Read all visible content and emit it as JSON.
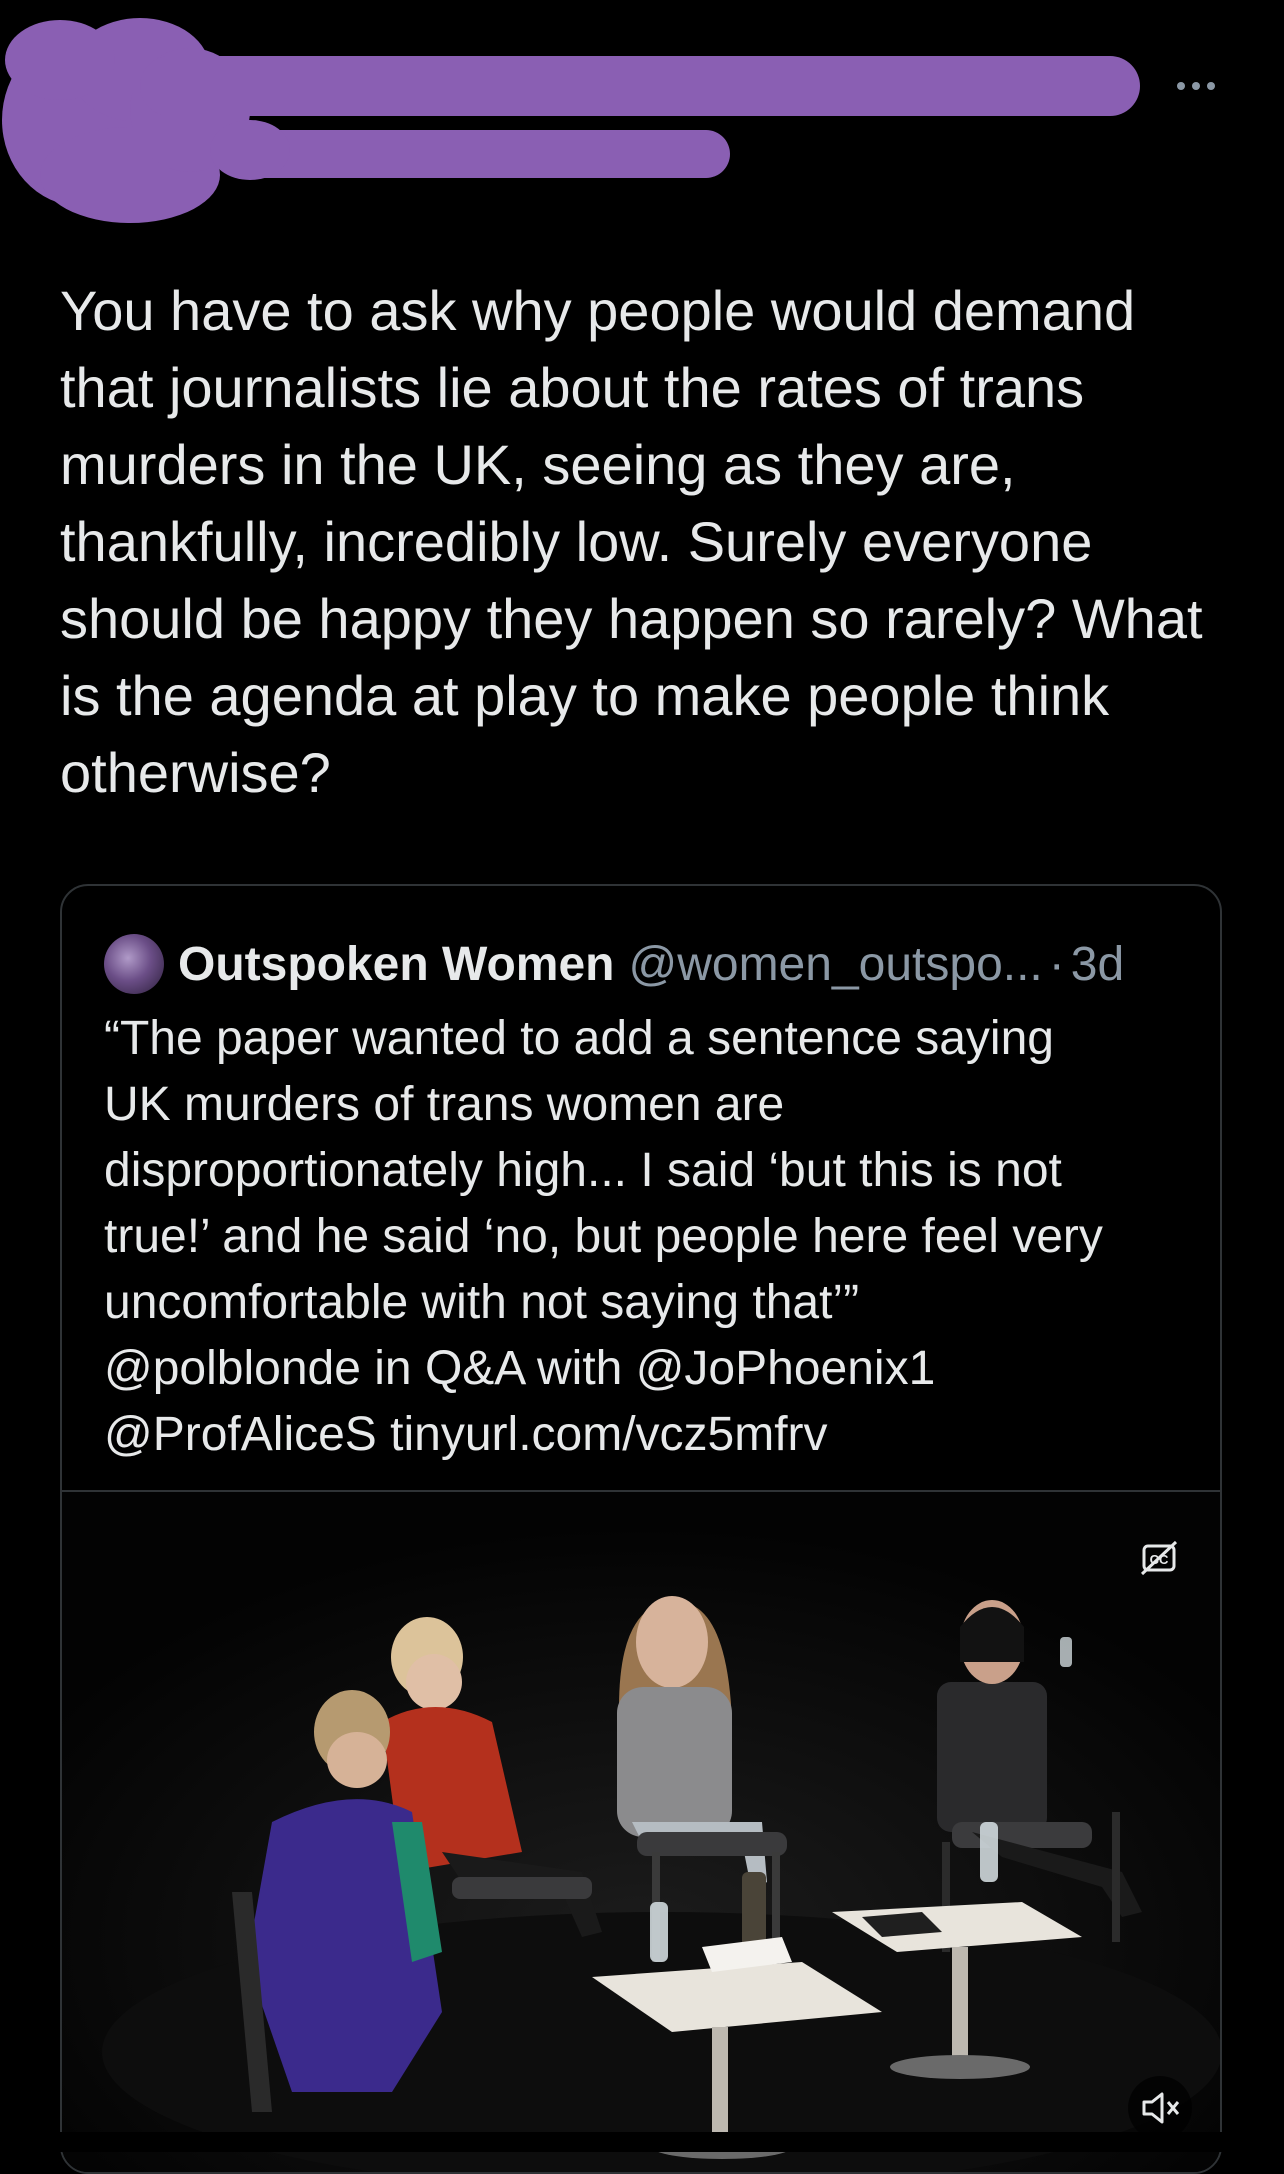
{
  "redaction": {
    "color": "#8a5fb3"
  },
  "more_menu": {
    "icon": "more-horizontal-icon"
  },
  "tweet": {
    "text": "You have to ask why people would demand\nthat journalists lie about the rates of trans\nmurders in the UK, seeing as they are,\nthankfully, incredibly low. Surely everyone\nshould be happy they happen so rarely? What\nis the agenda at play to make people think\notherwise?"
  },
  "quoted_tweet": {
    "display_name": "Outspoken Women",
    "handle": "@women_outspo...",
    "separator": "·",
    "time": "3d",
    "text": "“The paper wanted to add a sentence saying\nUK murders of trans women are\ndisproportionately high... I said ‘but this is not\ntrue!’ and he said ‘no, but people here feel very\nuncomfortable with not saying that’”\n@polblonde in Q&A with @JoPhoenix1\n@ProfAliceS tinyurl.com/vcz5mfrv",
    "media": {
      "type": "video",
      "captions_icon": "captions-off-icon",
      "mute_icon": "volume-muted-icon"
    }
  },
  "colors": {
    "background": "#000000",
    "text": "#e7e9ea",
    "secondary_text": "#8b98a5",
    "border": "#2f3336"
  }
}
